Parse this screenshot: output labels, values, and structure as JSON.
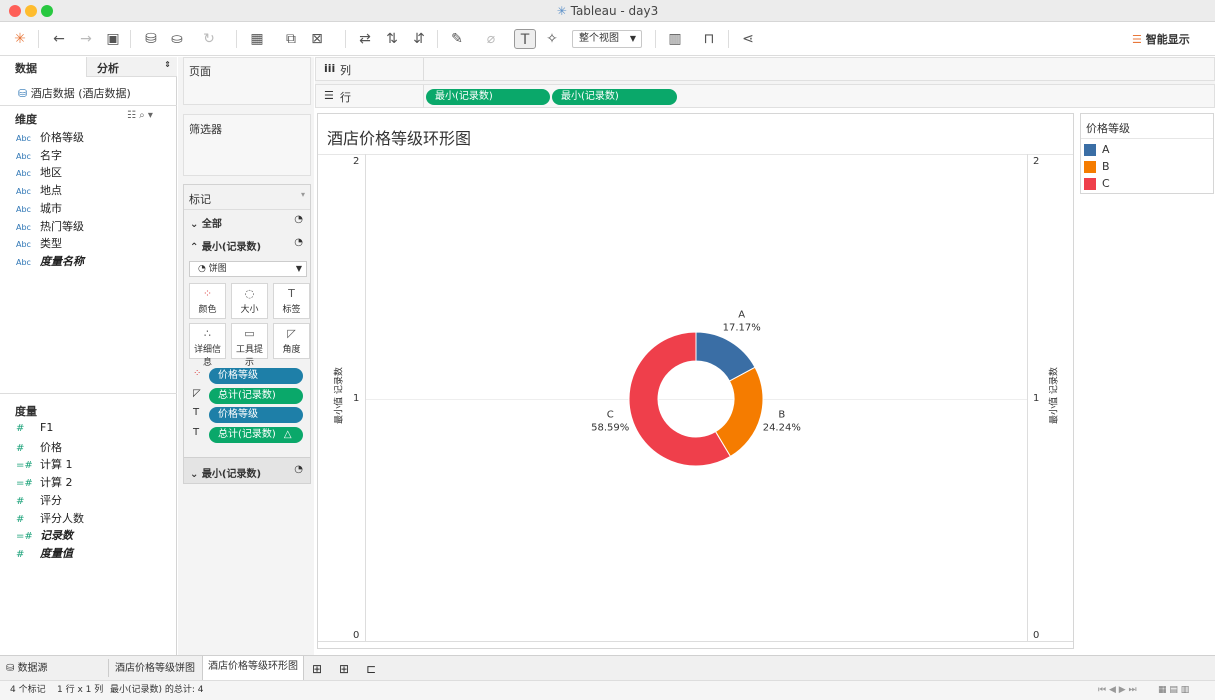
{
  "window": {
    "title": "Tableau - day3"
  },
  "toolbar": {
    "view_fit": "整个视图",
    "smart_show": "智能显示"
  },
  "sidebar": {
    "tab_data": "数据",
    "tab_analysis": "分析",
    "datasource": "酒店数据 (酒店数据)",
    "dimensions_header": "维度",
    "dimensions": [
      {
        "type": "Abc",
        "name": "价格等级"
      },
      {
        "type": "Abc",
        "name": "名字"
      },
      {
        "type": "Abc",
        "name": "地区"
      },
      {
        "type": "Abc",
        "name": "地点"
      },
      {
        "type": "Abc",
        "name": "城市"
      },
      {
        "type": "Abc",
        "name": "热门等级"
      },
      {
        "type": "Abc",
        "name": "类型"
      },
      {
        "type": "Abc",
        "name": "度量名称"
      }
    ],
    "measures_header": "度量",
    "measures": [
      {
        "type": "#",
        "name": "F1"
      },
      {
        "type": "#",
        "name": "价格"
      },
      {
        "type": "=#",
        "name": "计算 1"
      },
      {
        "type": "=#",
        "name": "计算 2"
      },
      {
        "type": "#",
        "name": "评分"
      },
      {
        "type": "#",
        "name": "评分人数"
      },
      {
        "type": "=#",
        "name": "记录数"
      },
      {
        "type": "#",
        "name": "度量值"
      }
    ]
  },
  "shelves": {
    "pages": "页面",
    "filters": "筛选器",
    "columns": "列",
    "rows": "行",
    "row_pills": [
      "最小(记录数)",
      "最小(记录数)"
    ]
  },
  "marks": {
    "title": "标记",
    "all": "全部",
    "layer1": "最小(记录数)",
    "mark_type": "饼图",
    "buttons": [
      {
        "label": "颜色",
        "icon": "color-icon"
      },
      {
        "label": "大小",
        "icon": "size-icon"
      },
      {
        "label": "标签",
        "icon": "label-icon"
      },
      {
        "label": "详细信息",
        "icon": "detail-icon"
      },
      {
        "label": "工具提示",
        "icon": "tooltip-icon"
      },
      {
        "label": "角度",
        "icon": "angle-icon"
      }
    ],
    "pills": [
      {
        "icon": "color-dots",
        "label": "价格等级",
        "color": "blue"
      },
      {
        "icon": "angle",
        "label": "总计(记录数)",
        "color": "green"
      },
      {
        "icon": "label",
        "label": "价格等级",
        "color": "blue"
      },
      {
        "icon": "label",
        "label": "总计(记录数)",
        "color": "green",
        "suffix": "△"
      }
    ],
    "layer2": "最小(记录数)"
  },
  "view": {
    "title": "酒店价格等级环形图",
    "axis_label": "最小值 记录数",
    "ticks": [
      "2",
      "1",
      "0"
    ]
  },
  "legend": {
    "title": "价格等级",
    "items": [
      {
        "label": "A",
        "color": "#3a6ea5"
      },
      {
        "label": "B",
        "color": "#f57c00"
      },
      {
        "label": "C",
        "color": "#ef3f4b"
      }
    ]
  },
  "chart_data": {
    "type": "pie",
    "title": "酒店价格等级环形图",
    "ylabel": "最小值 记录数",
    "ylim": [
      0,
      2
    ],
    "categories": [
      "A",
      "B",
      "C"
    ],
    "values": [
      17.17,
      24.24,
      58.59
    ],
    "value_labels": [
      "17.17%",
      "24.24%",
      "58.59%"
    ],
    "colors": [
      "#3a6ea5",
      "#f57c00",
      "#ef3f4b"
    ],
    "donut": true
  },
  "tabs": {
    "datasource": "数据源",
    "sheets": [
      "酒店价格等级饼图",
      "酒店价格等级环形图"
    ]
  },
  "status": {
    "marks": "4 个标记",
    "dims": "1 行 x 1 列",
    "sum": "最小(记录数) 的总计: 4"
  }
}
